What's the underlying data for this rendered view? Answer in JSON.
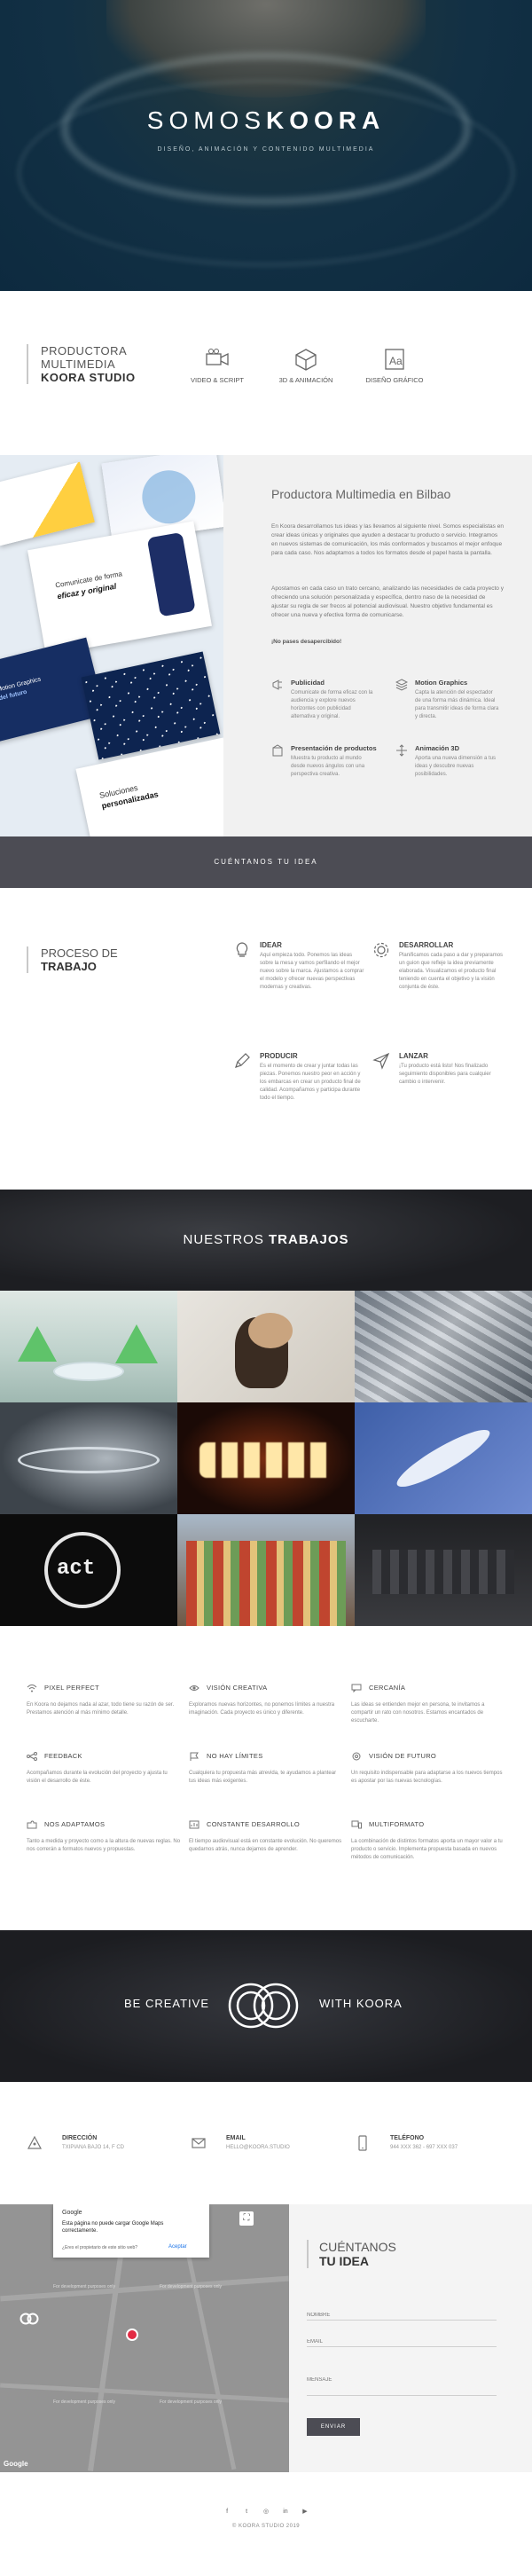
{
  "hero": {
    "title_light": "SOMOS",
    "title_bold": "KOORA",
    "subtitle": "DISEÑO, ANIMACIÓN Y CONTENIDO MULTIMEDIA"
  },
  "studio": {
    "line1": "PRODUCTORA",
    "line2": "MULTIMEDIA",
    "line3": "KOORA STUDIO",
    "services": [
      {
        "label": "VIDEO & SCRIPT",
        "icon": "video-camera-icon"
      },
      {
        "label": "3D & ANIMACIÓN",
        "icon": "cube-icon"
      },
      {
        "label": "DISEÑO GRÁFICO",
        "icon": "font-icon"
      }
    ]
  },
  "productora": {
    "heading": "Productora Multimedia en Bilbao",
    "para1": "En Koora desarrollamos tus ideas y las llevamos al siguiente nivel. Somos especialistas en crear ideas únicas y originales que ayuden a destacar tu producto o servicio. Integramos en nuevos sistemas de comunicación, los más conformados y buscamos el mejor enfoque para cada caso. Nos adaptamos a todos los formatos desde el papel hasta la pantalla.",
    "para2": "Apostamos en cada caso un trato cercano, analizando las necesidades de cada proyecto y ofreciendo una solución personalizada y específica, dentro naso de la necesidad de ajustar su regla de ser frecos al potencial audiovisual. Nuestro objetivo fundamental es ofrecer una nueva y efectiva forma de comunicarse.",
    "para3": "¡No pases desapercibido!",
    "features": [
      {
        "title": "Publicidad",
        "icon": "megaphone-icon",
        "desc": "Comunicate de forma eficaz con la audiencia y explore nuevos horizontes con publicidad alternativa y original."
      },
      {
        "title": "Motion Graphics",
        "icon": "layers-icon",
        "desc": "Capta la atención del espectador de una forma más dinámica. Ideal para transmitir ideas de forma clara y directa."
      },
      {
        "title": "Presentación de productos",
        "icon": "box-icon",
        "desc": "Muestra tu producto al mundo desde nuevos ángulos con una perspectiva creativa."
      },
      {
        "title": "Animación 3D",
        "icon": "arrows-icon",
        "desc": "Aporta una nueva dimensión a tus ideas y descubre nuevas posibilidades."
      }
    ],
    "mock": {
      "card1": "Comunicate de forma",
      "card1b": "eficaz y original",
      "card2": "Soluciones",
      "card2b": "personalizadas",
      "card3": "Motion Graphics",
      "card3b": "del futuro"
    }
  },
  "cta": {
    "label": "CUÉNTANOS TU IDEA"
  },
  "proceso": {
    "line1": "PROCESO DE",
    "line2": "TRABAJO",
    "steps": [
      {
        "title": "IDEAR",
        "icon": "lightbulb-icon",
        "desc": "Aquí empieza todo. Ponemos las ideas sobre la mesa y vamos perfilando el mejor nuevo sobre la marca. Ajustamos a comprar el modelo y ofrecer nuevas perspectivas modernas y creativas."
      },
      {
        "title": "DESARROLLAR",
        "icon": "gear-icon",
        "desc": "Planificamos cada paso a dar y preparamos un guion que refleje la idea previamente elaborada. Visualizamos el producto final teniendo en cuenta el objetivo y la visión conjunta de éste."
      },
      {
        "title": "PRODUCIR",
        "icon": "pencil-icon",
        "desc": "Es el momento de crear y juntar todas las piezas. Ponemos nuestro peor en acción y los embarcas en crear un producto final de calidad. Acompañamos y participa durante todo el tiempo."
      },
      {
        "title": "LANZAR",
        "icon": "send-icon",
        "desc": "¡Tu producto está listo! Nos finalizado seguimiento disponibles para cualquier cambio o intervenir."
      }
    ]
  },
  "trabajos": {
    "light": "NUESTROS",
    "bold": "TRABAJOS"
  },
  "grid": [
    {
      "title": "PIXEL PERFECT",
      "icon": "wifi-icon",
      "desc": "En Koora no dejamos nada al azar, todo tiene su razón de ser. Prestamos atención al más mínimo detalle."
    },
    {
      "title": "VISIÓN CREATIVA",
      "icon": "eye-icon",
      "desc": "Exploramos nuevas horizontes, no ponemos límites a nuestra imaginación. Cada proyecto es único y diferente."
    },
    {
      "title": "CERCANÍA",
      "icon": "chat-icon",
      "desc": "Las ideas se entienden mejor en persona, te invitamos a compartir un rato con nosotros. Estamos encantados de escucharte."
    },
    {
      "title": "FEEDBACK",
      "icon": "share-icon",
      "desc": "Acompañamos durante la evolución del proyecto y ajusta tu visión el desarrollo de éste."
    },
    {
      "title": "NO HAY LÍMITES",
      "icon": "flag-icon",
      "desc": "Cualquiera tu propuesta más atrevida, te ayudamos a plantear tus ideas más exigentes."
    },
    {
      "title": "VISIÓN DE FUTURO",
      "icon": "target-icon",
      "desc": "Un requisito indispensable para adaptarse a los nuevos tiempos es apostar por las nuevas tecnologías."
    },
    {
      "title": "NOS ADAPTAMOS",
      "icon": "puzzle-icon",
      "desc": "Tanto a medida y proyecto como a la altura de nuevas reglas. No nos correrán a formatos nuevos y propuestas."
    },
    {
      "title": "CONSTANTE DESARROLLO",
      "icon": "chart-icon",
      "desc": "El tiempo audiovisual está en constante evolución. No queremos quedarnos atrás, nunca dejamos de aprender."
    },
    {
      "title": "MULTIFORMATO",
      "icon": "devices-icon",
      "desc": "La combinación de distintos formatos aporta un mayor valor a tu producto o servicio. Implementa propuesta basada en nuevos métodos de comunicación."
    }
  ],
  "create": {
    "left": "BE CREATIVE",
    "right": "WITH KOORA"
  },
  "contact": [
    {
      "title": "DIRECCIÓN",
      "icon": "location-icon",
      "value": "TXIPIANA BAJO 14, F CD"
    },
    {
      "title": "EMAIL",
      "icon": "mail-icon",
      "value": "HELLO@KOORA.STUDIO"
    },
    {
      "title": "TELÉFONO",
      "icon": "phone-icon",
      "value": "944 XXX 362 - 697 XXX 037"
    }
  ],
  "map": {
    "brand": "Google",
    "notice": "Esta página no puede cargar Google Maps correctamente.",
    "owner_q": "¿Eres el propietario de este sitio web?",
    "accept": "Aceptar",
    "dev": "For development purposes only",
    "footer_brand": "Google"
  },
  "form": {
    "line1": "CUÉNTANOS",
    "line2": "TU IDEA",
    "name_ph": "NOMBRE",
    "email_ph": "EMAIL",
    "msg_ph": "MENSAJE",
    "send": "ENVIAR"
  },
  "footer": {
    "social": [
      "f",
      "t",
      "◎",
      "in",
      "▶"
    ],
    "copy": "© KOORA STUDIO 2019"
  }
}
